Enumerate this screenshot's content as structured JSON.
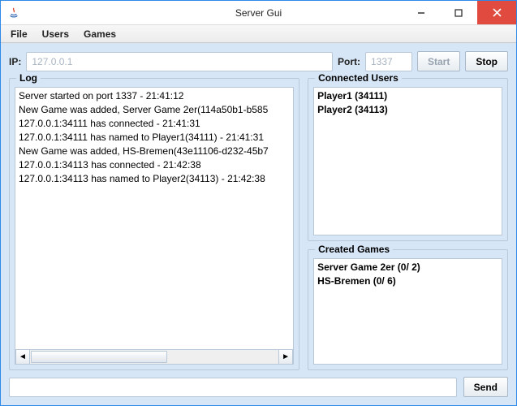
{
  "window": {
    "title": "Server Gui"
  },
  "menu": {
    "file": "File",
    "users": "Users",
    "games": "Games"
  },
  "toolbar": {
    "ip_label": "IP:",
    "ip_value": "127.0.0.1",
    "port_label": "Port:",
    "port_value": "1337",
    "start_label": "Start",
    "stop_label": "Stop"
  },
  "log": {
    "title": "Log",
    "lines": [
      "Server started on port 1337 - 21:41:12",
      "New Game was added, Server Game 2er(114a50b1-b585",
      "127.0.0.1:34111 has connected - 21:41:31",
      "127.0.0.1:34111 has named to Player1(34111) - 21:41:31",
      "New Game was added, HS-Bremen(43e11106-d232-45b7",
      "127.0.0.1:34113 has connected - 21:42:38",
      "127.0.0.1:34113 has named to Player2(34113) - 21:42:38"
    ]
  },
  "users": {
    "title": "Connected Users",
    "items": [
      "Player1 (34111)",
      "Player2 (34113)"
    ]
  },
  "games": {
    "title": "Created Games",
    "items": [
      "Server Game 2er (0/ 2)",
      "HS-Bremen (0/ 6)"
    ]
  },
  "bottom": {
    "msg_value": "",
    "msg_placeholder": "",
    "send_label": "Send"
  }
}
